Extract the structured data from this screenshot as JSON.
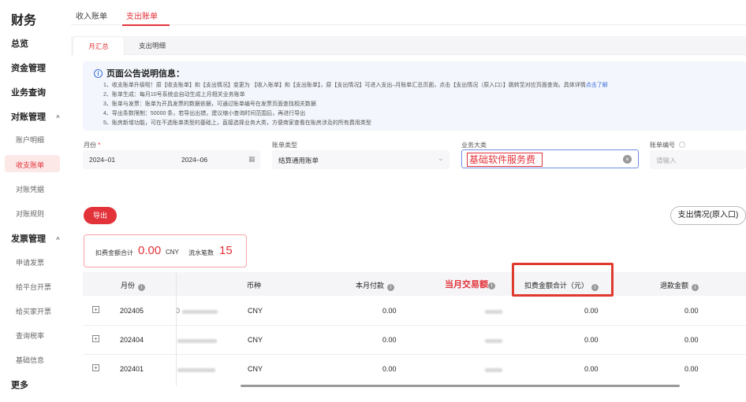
{
  "sidebar": {
    "title": "财务",
    "items": [
      {
        "label": "总览"
      },
      {
        "label": "资金管理"
      },
      {
        "label": "业务查询"
      },
      {
        "label": "对账管理",
        "caret": "^"
      },
      {
        "label": "账户明细"
      },
      {
        "label": "收支账单"
      },
      {
        "label": "对账凭据"
      },
      {
        "label": "对账规则"
      },
      {
        "label": "发票管理",
        "caret": "^"
      },
      {
        "label": "申请发票"
      },
      {
        "label": "给平台开票"
      },
      {
        "label": "给买家开票"
      },
      {
        "label": "查询税率"
      },
      {
        "label": "基础信息"
      },
      {
        "label": "更多"
      }
    ]
  },
  "top_tabs": [
    {
      "label": "收入账单"
    },
    {
      "label": "支出账单"
    }
  ],
  "sub_tabs": [
    {
      "label": "月汇总"
    },
    {
      "label": "支出明细"
    }
  ],
  "notice": {
    "title": "页面公告说明信息：",
    "lines": [
      "1、收支账单升级啦！原【收支账单】和【支出情况】变更为 【收入账单】和【支出账单】，原【支出情况】可进入支出–月账单汇总页面，点击【支出情况（原入口）】跳转至对应页面查询。具体详情",
      "2、账单生成：每月10号系统会自动生成上月相关业务账单",
      "3、账单与发票：账单为开具发票的数据依据，可通过账单编号在发票页面查找相关数据",
      "4、导出条数限制：50000 条，若导出出错，建议缩小查询时间范围后，再进行导出",
      "5、账房新增功能，可在不选账单类型的基础上，直接选择业务大类，方便商家查看在账房涉及的所有费用类型"
    ],
    "link": "点击了解"
  },
  "filters": {
    "month_label": "月份",
    "required_mark": "*",
    "month_start": "2024–01",
    "month_end": "2024–06",
    "bill_type_label": "账单类型",
    "bill_type_value": "结算通用账单",
    "biz_category_label": "业务大类",
    "biz_category_value": "基础软件服务费",
    "bill_no_label": "账单编号",
    "bill_no_placeholder": "请输入"
  },
  "actions": {
    "export": "导出",
    "legacy_entry": "支出情况(原入口)"
  },
  "summary": {
    "deduct_label": "扣费金额合计",
    "deduct_value": "0.00",
    "currency": "CNY",
    "count_label": "流水笔数",
    "count_value": "15"
  },
  "table": {
    "headers": [
      "月份",
      "币种",
      "本月付款",
      "当月交易额",
      "扣费金额合计（元）",
      "退款金额"
    ],
    "rows": [
      {
        "month": "202405",
        "currency": "CNY",
        "paid": "0.00",
        "deduct": "0.00",
        "refund": "0.00"
      },
      {
        "month": "202404",
        "currency": "CNY",
        "paid": "0.00",
        "deduct": "0.00",
        "refund": "0.00"
      },
      {
        "month": "202401",
        "currency": "CNY",
        "paid": "0.00",
        "deduct": "0.00",
        "refund": "0.00"
      }
    ]
  },
  "colors": {
    "accent": "#e2323a",
    "link": "#3b6fd8",
    "annotation": "#e03a2e"
  }
}
